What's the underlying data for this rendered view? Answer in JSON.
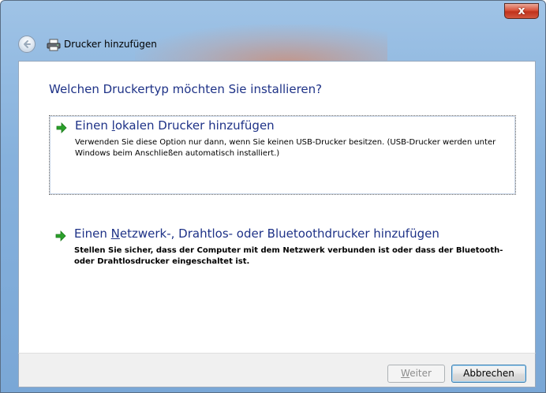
{
  "window": {
    "title": "Drucker hinzufügen",
    "close_label": "x"
  },
  "main": {
    "heading": "Welchen Druckertyp möchten Sie installieren?",
    "options": [
      {
        "title_pre": "Einen ",
        "title_accel": "l",
        "title_post": "okalen Drucker hinzufügen",
        "description": "Verwenden Sie diese Option nur dann, wenn Sie keinen USB-Drucker besitzen. (USB-Drucker werden unter Windows beim Anschließen automatisch installiert.)",
        "icon": "green-arrow-icon"
      },
      {
        "title_pre": "Einen ",
        "title_accel": "N",
        "title_post": "etzwerk-, Drahtlos- oder Bluetoothdrucker hinzufügen",
        "description": "Stellen Sie sicher, dass der Computer mit dem Netzwerk verbunden ist oder dass der Bluetooth- oder Drahtlosdrucker eingeschaltet ist.",
        "icon": "green-arrow-icon"
      }
    ]
  },
  "footer": {
    "next_accel": "W",
    "next_post": "eiter",
    "cancel_label": "Abbrechen"
  },
  "colors": {
    "heading": "#1e3287",
    "arrow": "#2aa12a"
  }
}
